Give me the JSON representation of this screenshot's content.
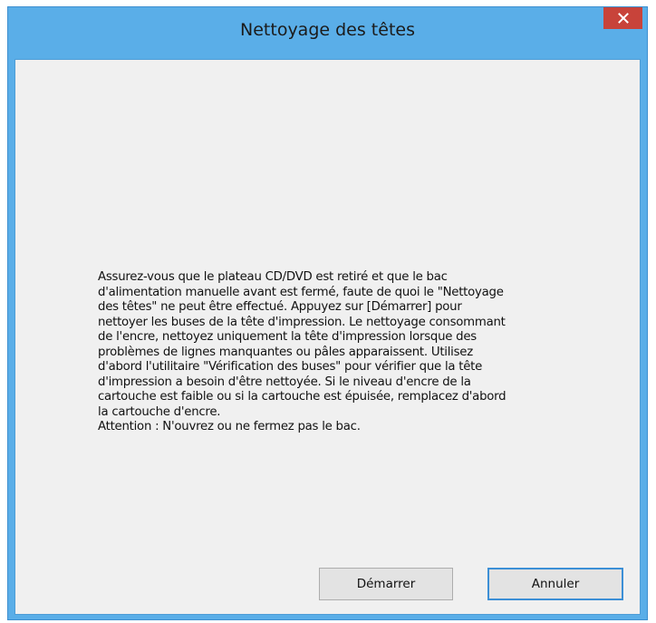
{
  "window": {
    "title": "Nettoyage des têtes"
  },
  "message": {
    "lines": [
      "Assurez-vous que le plateau CD/DVD est retiré et que le bac",
      "d'alimentation manuelle avant est fermé, faute de quoi le \"Nettoyage",
      "des têtes\" ne peut être effectué. Appuyez sur [Démarrer] pour",
      "nettoyer les buses de la tête d'impression. Le nettoyage consommant",
      "de l'encre, nettoyez uniquement la tête d'impression lorsque des",
      "problèmes de lignes manquantes ou pâles apparaissent. Utilisez",
      "d'abord l'utilitaire \"Vérification des buses\" pour vérifier que la tête",
      "d'impression a besoin d'être nettoyée. Si le niveau d'encre de la",
      "cartouche est faible ou si la cartouche est épuisée, remplacez d'abord",
      "la cartouche d'encre.",
      "Attention : N'ouvrez ou ne fermez pas le bac."
    ]
  },
  "buttons": {
    "start_label": "Démarrer",
    "cancel_label": "Annuler"
  },
  "icons": {
    "close": "close-icon"
  },
  "colors": {
    "titlebar": "#5aaee8",
    "close_button": "#c8433a",
    "client_background": "#f0f0f0",
    "default_button_border": "#3c8fd6"
  }
}
